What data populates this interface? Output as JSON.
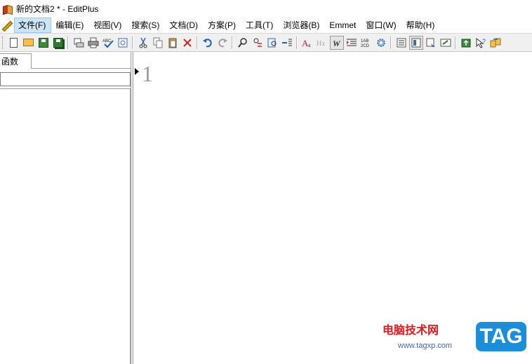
{
  "window": {
    "title": "新的文档2 * - EditPlus"
  },
  "menu": {
    "items": [
      {
        "label": "文件(F)",
        "active": true
      },
      {
        "label": "编辑(E)"
      },
      {
        "label": "视图(V)"
      },
      {
        "label": "搜索(S)"
      },
      {
        "label": "文档(D)"
      },
      {
        "label": "方案(P)"
      },
      {
        "label": "工具(T)"
      },
      {
        "label": "浏览器(B)"
      },
      {
        "label": "Emmet"
      },
      {
        "label": "窗口(W)"
      },
      {
        "label": "帮助(H)"
      }
    ]
  },
  "toolbar": {
    "buttons": [
      "new-file-icon",
      "open-folder-icon",
      "save-icon",
      "save-all-icon",
      "print-preview-icon",
      "print-icon",
      "spell-check-icon",
      "browser-preview-icon",
      "cut-icon",
      "copy-icon",
      "paste-icon",
      "delete-icon",
      "undo-icon",
      "redo-icon",
      "find-icon",
      "replace-icon",
      "find-in-files-icon",
      "goto-line-icon",
      "font-icon",
      "hex-icon",
      "word-wrap-icon",
      "indent-icon",
      "ruler-icon",
      "settings-gear-icon",
      "toggle-panel-icon",
      "output-window-icon",
      "cliptext-icon",
      "fullscreen-icon",
      "ftp-upload-icon",
      "help-pointer-icon",
      "plugin-icon"
    ],
    "labels": {
      "spell": "ABC",
      "hex": "Hx",
      "wrap": "W",
      "ruler_top": "1AB",
      "ruler_bottom": "2CD",
      "font": "A",
      "font_sub": "a"
    },
    "accent_colors": {
      "undo": "#1f5fbf",
      "delete": "#cc2222",
      "gear": "#4a7fb8"
    }
  },
  "sidebar": {
    "tab_label": "函数",
    "filter_value": ""
  },
  "editor": {
    "line_number": "1"
  },
  "watermark": {
    "title": "电脑技术网",
    "url": "www.tagxp.com",
    "badge": "TAG"
  }
}
